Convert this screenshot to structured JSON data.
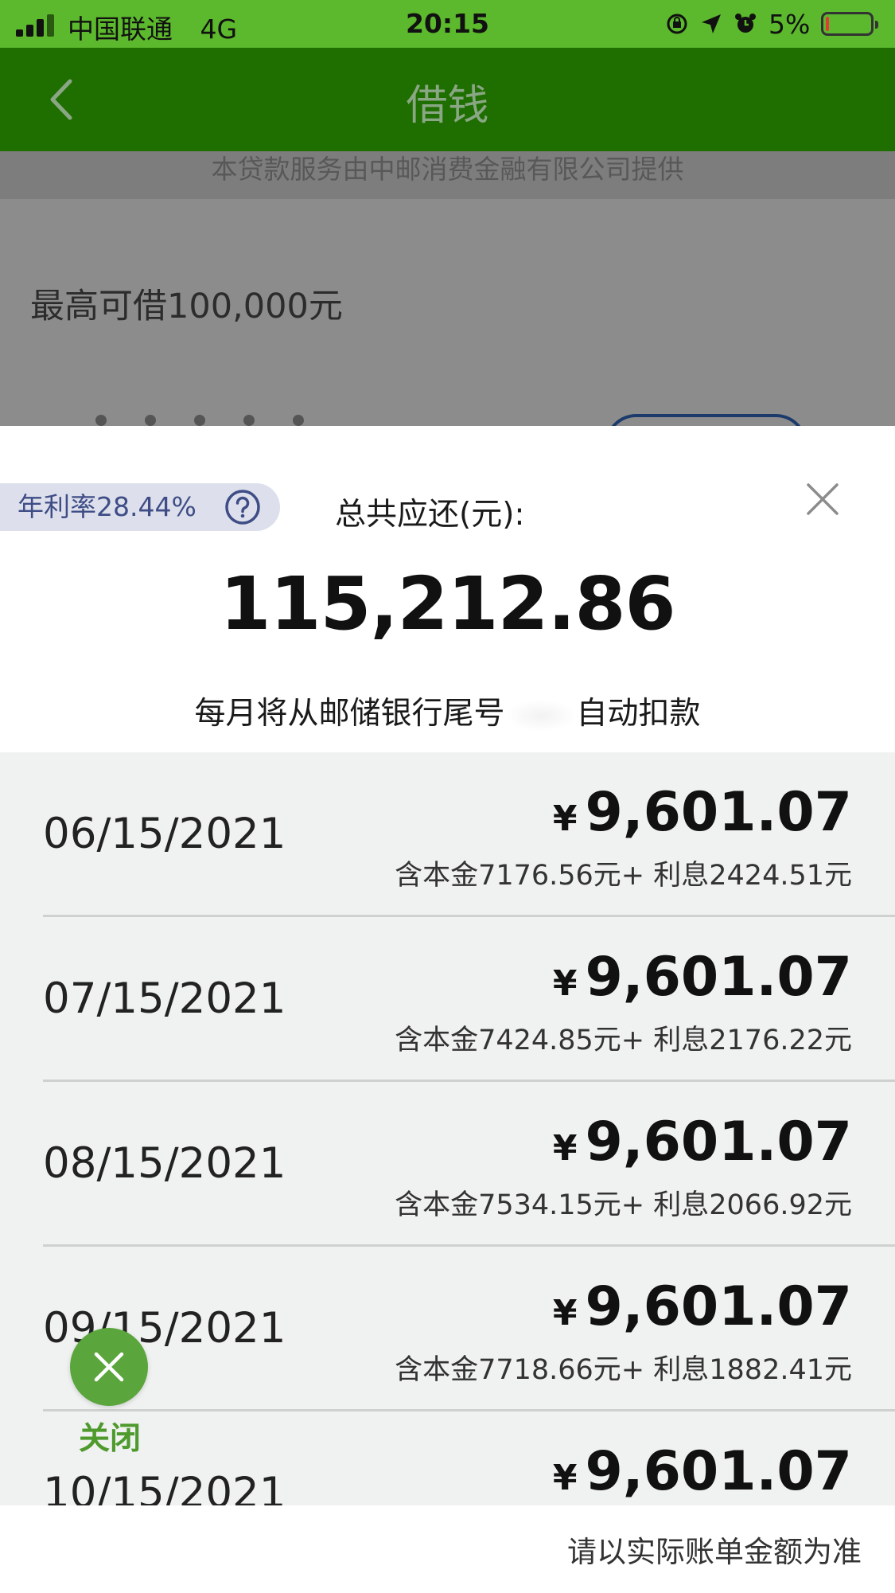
{
  "status_bar": {
    "carrier": "中国联通",
    "network": "4G",
    "time": "20:15",
    "battery": "5%",
    "icons": [
      "signal-icon",
      "rotation-lock-icon",
      "location-icon",
      "alarm-icon",
      "battery-icon"
    ]
  },
  "nav": {
    "title": "借钱",
    "back_icon": "chevron-left-icon"
  },
  "background_page": {
    "provider_note": "本贷款服务由中邮消费金融有限公司提供",
    "max_borrow": "最高可借100,000元"
  },
  "modal": {
    "rate_label": "年利率28.44%",
    "help_icon": "question-circle-icon",
    "total_label": "总共应还(元):",
    "total_amount": "115,212.86",
    "debit_prefix": "每月将从邮储银行尾号",
    "debit_suffix": "自动扣款",
    "close_icon": "close-icon"
  },
  "schedule": {
    "currency_symbol": "¥",
    "rows": [
      {
        "date": "06/15/2021",
        "amount": "9,601.07",
        "breakdown": "含本金7176.56元+ 利息2424.51元"
      },
      {
        "date": "07/15/2021",
        "amount": "9,601.07",
        "breakdown": "含本金7424.85元+ 利息2176.22元"
      },
      {
        "date": "08/15/2021",
        "amount": "9,601.07",
        "breakdown": "含本金7534.15元+ 利息2066.92元"
      },
      {
        "date": "09/15/2021",
        "amount": "9,601.07",
        "breakdown": "含本金7718.66元+ 利息1882.41元"
      },
      {
        "date": "10/15/2021",
        "amount": "9,601.07",
        "breakdown": ""
      }
    ]
  },
  "footer": {
    "note": "请以实际账单金额为准"
  },
  "floating_close": {
    "label": "关闭",
    "icon": "close-icon"
  },
  "colors": {
    "status_bar": "#5cb82c",
    "nav_bar": "#1f6e00",
    "rate_badge_bg": "#dde0ec",
    "rate_badge_text": "#3f4d86",
    "floating_close": "#5aa63c"
  }
}
